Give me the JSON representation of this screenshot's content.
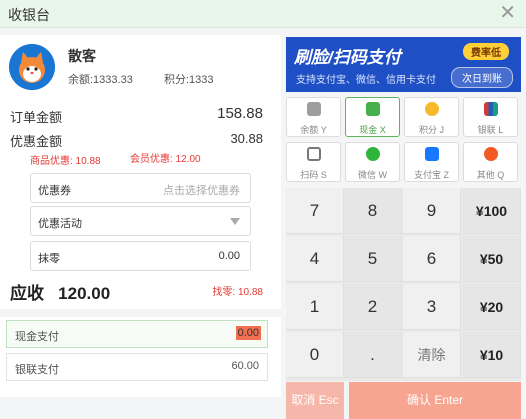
{
  "window": {
    "title": "收银台",
    "close_icon": "close-icon"
  },
  "member": {
    "name": "散客",
    "balance": "余额:1333.33",
    "points": "积分:1333"
  },
  "order": {
    "total_label": "订单金额",
    "total_value": "158.88",
    "discount_label": "优惠金额",
    "discount_value": "30.88",
    "goods_discount": "商品优惠: 10.88",
    "member_discount": "会员优惠: 12.00",
    "coupon_label": "优惠券",
    "coupon_placeholder": "点击选择优惠券",
    "promo_label": "优惠活动",
    "rounding_label": "抹零",
    "rounding_value": "0.00",
    "due_label": "应收",
    "due_value": "120.00",
    "change_text": "找零: 10.88"
  },
  "payments": [
    {
      "label": "现金支付",
      "value": "0.00"
    },
    {
      "label": "银联支付",
      "value": "60.00"
    }
  ],
  "banner": {
    "title": "刷脸/扫码支付",
    "subtitle": "支持支付宝、微信、信用卡支付",
    "badge": "费率低",
    "settle": "次日到账"
  },
  "methods": [
    {
      "label": "余额  Y",
      "icon": "wallet-icon",
      "color": "#9e9e9e"
    },
    {
      "label": "现金  X",
      "icon": "cash-icon",
      "color": "#43b049"
    },
    {
      "label": "积分  J",
      "icon": "coins-icon",
      "color": "#f5b92a"
    },
    {
      "label": "银联  L",
      "icon": "unionpay-icon",
      "color": "#d23a3a"
    },
    {
      "label": "扫码  S",
      "icon": "scan-icon",
      "color": "#777777"
    },
    {
      "label": "微信  W",
      "icon": "wechat-icon",
      "color": "#2fb53a"
    },
    {
      "label": "支付宝  Z",
      "icon": "alipay-icon",
      "color": "#1677ff"
    },
    {
      "label": "其他  Q",
      "icon": "more-icon",
      "color": "#f25a24"
    }
  ],
  "keypad": {
    "keys": [
      "7",
      "8",
      "9",
      "¥100",
      "4",
      "5",
      "6",
      "¥50",
      "1",
      "2",
      "3",
      "¥20",
      "0",
      ".",
      "清除",
      "¥10"
    ]
  },
  "actions": {
    "cancel": "取消 Esc",
    "confirm": "确认 Enter"
  }
}
